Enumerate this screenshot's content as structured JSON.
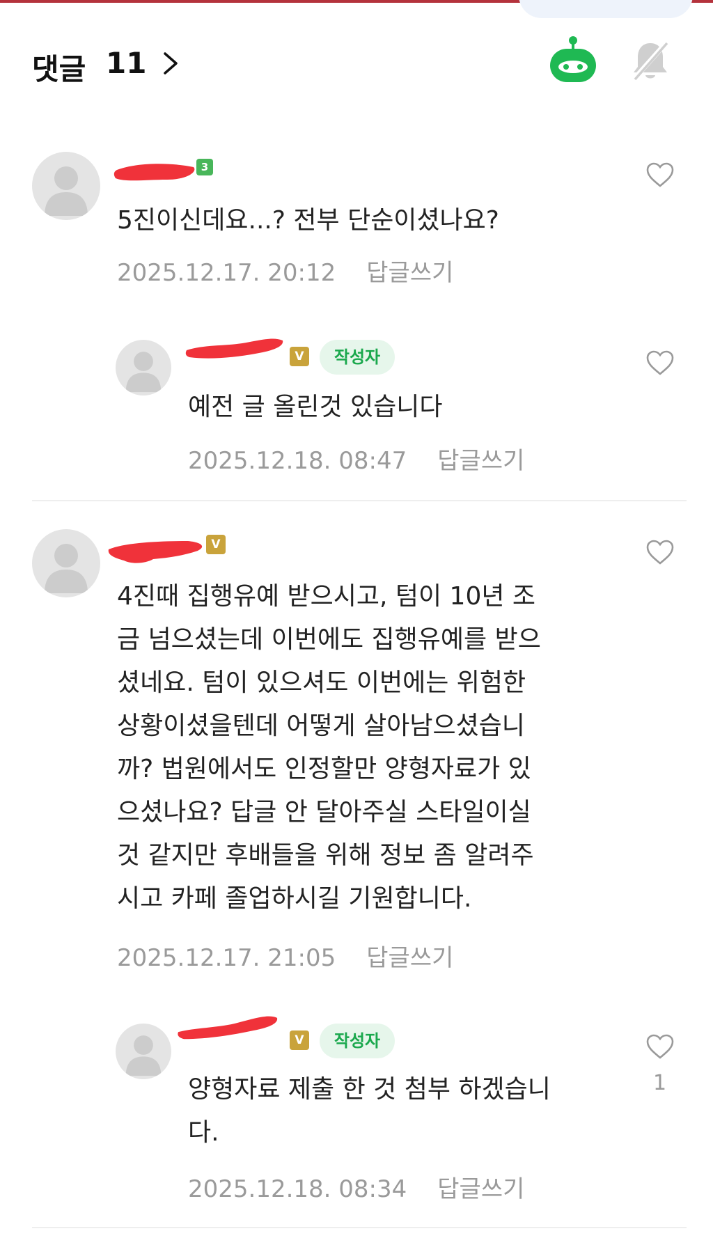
{
  "header": {
    "title": "댓글",
    "count": "11"
  },
  "colors": {
    "accent_green": "#1fb953",
    "author_badge_bg": "#e6f6eb",
    "author_badge_text": "#1aa84d",
    "redaction": "#f0323a",
    "level_gold": "#c9a33b",
    "level_green": "#48b65a"
  },
  "icons": {
    "header_arrow": "chevron-right-icon",
    "header_bot": "robot-icon",
    "header_bell": "bell-off-icon",
    "like": "heart-icon",
    "avatar": "default-avatar-icon"
  },
  "comments": [
    {
      "nickname": "",
      "level": "3",
      "text": "5진이신데요...? 전부 단순이셨나요?",
      "date": "2025.12.17. 20:12",
      "reply_label": "답글쓰기"
    },
    {
      "nickname": "",
      "level": "V",
      "author_badge": "작성자",
      "text": "예전 글 올린것 있습니다",
      "date": "2025.12.18. 08:47",
      "reply_label": "답글쓰기"
    },
    {
      "nickname": "",
      "level": "V",
      "text": "4진때 집행유예 받으시고, 텀이 10년 조\n금 넘으셨는데 이번에도 집행유예를 받으\n셨네요. 텀이 있으셔도 이번에는 위험한\n상황이셨을텐데 어떻게 살아남으셨습니\n까? 법원에서도 인정할만 양형자료가 있\n으셨나요? 답글 안 달아주실 스타일이실\n것 같지만 후배들을 위해 정보 좀 알려주\n시고 카페 졸업하시길 기원합니다.",
      "date": "2025.12.17. 21:05",
      "reply_label": "답글쓰기"
    },
    {
      "nickname": "",
      "level": "V",
      "author_badge": "작성자",
      "text": "양형자료 제출 한 것 첨부 하겠습니\n다.",
      "date": "2025.12.18. 08:34",
      "reply_label": "답글쓰기",
      "like_count": "1"
    }
  ]
}
